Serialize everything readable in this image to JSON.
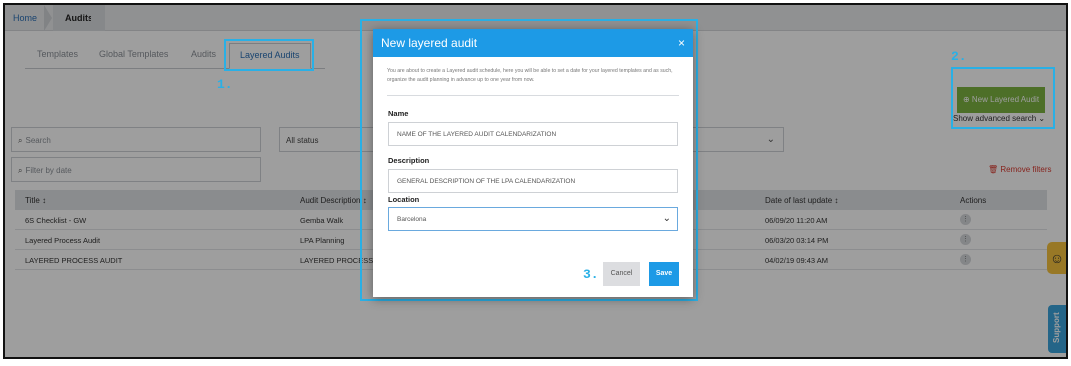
{
  "breadcrumb": {
    "home": "Home",
    "current": "Audits"
  },
  "tabs": [
    {
      "label": "Templates"
    },
    {
      "label": "Global Templates"
    },
    {
      "label": "Audits"
    },
    {
      "label": "Layered Audits"
    }
  ],
  "filters": {
    "search_placeholder": "Search",
    "status_value": "All status",
    "date_placeholder": "Filter by date",
    "remove_filters": "Remove filters",
    "advanced_search": "Show advanced search"
  },
  "actions": {
    "new_layered_audit": "New Layered Audit"
  },
  "table": {
    "headers": {
      "title": "Title",
      "description": "Audit Description",
      "last_update": "Date of last update",
      "actions": "Actions"
    },
    "rows": [
      {
        "title": "6S Checklist - GW",
        "description": "Gemba Walk",
        "last_update": "06/09/20 11:20 AM"
      },
      {
        "title": "Layered Process Audit",
        "description": "LPA Planning",
        "last_update": "06/03/20 03:14 PM"
      },
      {
        "title": "LAYERED PROCESS AUDIT",
        "description": "LAYERED PROCESS AU",
        "last_update": "04/02/19 09:43 AM"
      }
    ]
  },
  "side_widgets": {
    "support": "Support"
  },
  "callouts": [
    "1.",
    "2.",
    "3."
  ],
  "modal": {
    "title": "New layered audit",
    "close": "×",
    "intro": "You are about to create a Layered audit schedule, here you will be able to set a date for your layered templates and as such, organize the audit planning in advance up to one year from now.",
    "name_label": "Name",
    "name_value": "NAME OF THE LAYERED AUDIT CALENDARIZATION",
    "description_label": "Description",
    "description_value": "GENERAL DESCRIPTION OF THE LPA CALENDARIZATION",
    "location_label": "Location",
    "location_value": "Barcelona",
    "cancel": "Cancel",
    "save": "Save"
  },
  "colors": {
    "primary": "#1d9ae6",
    "callout": "#29b0e6",
    "new_button": "#7cb342",
    "danger": "#d9392f"
  }
}
